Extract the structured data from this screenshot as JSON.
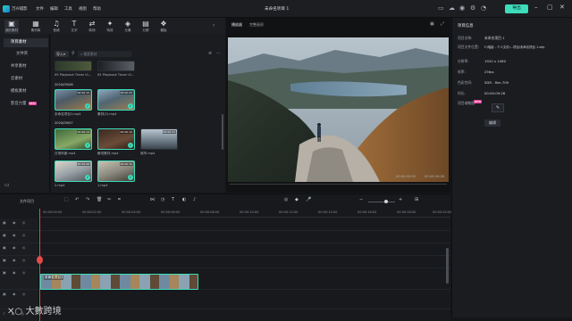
{
  "app": {
    "logo_text": "万兴喵影",
    "menus": [
      "文件",
      "编辑",
      "工具",
      "视图",
      "帮助"
    ],
    "project_title": "未命名项目 1",
    "export_label": "导出"
  },
  "toolbar": {
    "items": [
      {
        "icon": "media-icon",
        "glyph": "▣",
        "label": "我的素材"
      },
      {
        "icon": "stock-icon",
        "glyph": "▦",
        "label": "素材库"
      },
      {
        "icon": "audio-icon",
        "glyph": "♫",
        "label": "音频"
      },
      {
        "icon": "text-icon",
        "glyph": "T",
        "label": "文字"
      },
      {
        "icon": "transition-icon",
        "glyph": "⇄",
        "label": "转场"
      },
      {
        "icon": "effect-icon",
        "glyph": "✦",
        "label": "特效"
      },
      {
        "icon": "element-icon",
        "glyph": "◈",
        "label": "元素"
      },
      {
        "icon": "split-icon",
        "glyph": "▤",
        "label": "分屏"
      },
      {
        "icon": "template-icon",
        "glyph": "❖",
        "label": "模板"
      }
    ]
  },
  "sidebar": {
    "items": [
      {
        "label": "项目素材",
        "active": true
      },
      {
        "label": "文件夹",
        "active": false
      },
      {
        "label": "共享素材",
        "active": false
      },
      {
        "label": "云素材",
        "active": false
      },
      {
        "label": "模板素材",
        "active": false
      },
      {
        "label": "影音力量",
        "active": false
      }
    ],
    "ai_badge": "NEW"
  },
  "media": {
    "import_label": "导入",
    "search_placeholder": "搜索素材",
    "top_captions": [
      "09 Playback Timer Vi...",
      "05 Playback Timer Vi..."
    ],
    "groups": [
      {
        "date": "2024/09/08",
        "items": [
          {
            "caption": "未命名项目1.mp4",
            "duration": "00:00:15",
            "selected": true
          },
          {
            "caption": "素材(2).mp4",
            "duration": "00:00:20",
            "selected": true
          }
        ]
      },
      {
        "date": "2024/09/07",
        "items": [
          {
            "caption": "日常风景.mp4",
            "duration": "00:00:14",
            "selected": true
          },
          {
            "caption": "解说素材.mp4",
            "duration": "00:00:12",
            "selected": true
          },
          {
            "caption": "城市.mp4",
            "duration": "00:00:11",
            "selected": false
          },
          {
            "caption": "2.mp4",
            "duration": "00:00:08",
            "selected": true
          },
          {
            "caption": "1.mp4",
            "duration": "00:00:10",
            "selected": true
          }
        ]
      }
    ]
  },
  "preview": {
    "tab_player": "播放器",
    "tab_quality": "完整画质",
    "timecode": "00:00:00:00",
    "duration": "00:00:09:28"
  },
  "properties": {
    "heading": "项目信息",
    "rows": [
      {
        "label": "项目名称:",
        "value": "未命名项目 1"
      },
      {
        "label": "项目文件位置:",
        "value": "F:/喵影 - 个人文件/...项目/未命名项目 1.wfp"
      },
      {
        "label": "分辨率:",
        "value": "1920 x 1080"
      },
      {
        "label": "帧率:",
        "value": "25fps"
      },
      {
        "label": "色彩空间:",
        "value": "SDR - Rec.709"
      },
      {
        "label": "时长:",
        "value": "00:00:09:28"
      },
      {
        "label": "项目缩略图:",
        "value": ""
      }
    ],
    "badge": "NEW",
    "edit_button": "编辑"
  },
  "timeline": {
    "panel_label": "文件项目",
    "ruler": [
      "00:00:00:00",
      "00:00:02:00",
      "00:00:04:00",
      "00:00:06:00",
      "00:00:08:00",
      "00:00:10:00",
      "00:00:12:00",
      "00:00:14:00",
      "00:00:16:00",
      "00:00:18:00",
      "00:00:20:00"
    ],
    "clip_title": "未命名项目1",
    "playhead_time_sec": 0
  },
  "watermark": {
    "text": "大數跨境"
  }
}
